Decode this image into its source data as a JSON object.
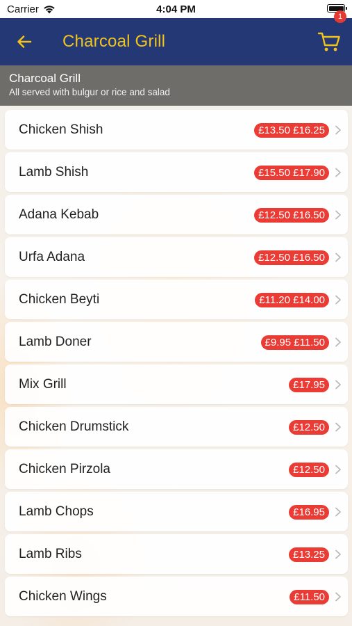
{
  "status_bar": {
    "carrier": "Carrier",
    "time": "4:04 PM"
  },
  "nav": {
    "title": "Charcoal Grill",
    "cart_count": "1",
    "icons": {
      "back": "arrow-left-icon",
      "cart": "shopping-cart-icon"
    },
    "colors": {
      "nav_bg": "#233874",
      "accent": "#f2c31b"
    }
  },
  "category": {
    "title": "Charcoal Grill",
    "subtitle": "All served with bulgur or rice and salad"
  },
  "menu_items": [
    {
      "name": "Chicken Shish",
      "price": "£13.50 £16.25"
    },
    {
      "name": "Lamb Shish",
      "price": "£15.50 £17.90"
    },
    {
      "name": "Adana Kebab",
      "price": "£12.50 £16.50"
    },
    {
      "name": "Urfa Adana",
      "price": "£12.50 £16.50"
    },
    {
      "name": "Chicken Beyti",
      "price": "£11.20 £14.00"
    },
    {
      "name": "Lamb Doner",
      "price": "£9.95 £11.50"
    },
    {
      "name": "Mix Grill",
      "price": "£17.95"
    },
    {
      "name": "Chicken Drumstick",
      "price": "£12.50"
    },
    {
      "name": "Chicken Pirzola",
      "price": "£12.50"
    },
    {
      "name": "Lamb Chops",
      "price": "£16.95"
    },
    {
      "name": "Lamb Ribs",
      "price": "£13.25"
    },
    {
      "name": "Chicken Wings",
      "price": "£11.50"
    }
  ],
  "price_badge_color": "#ea3b35"
}
